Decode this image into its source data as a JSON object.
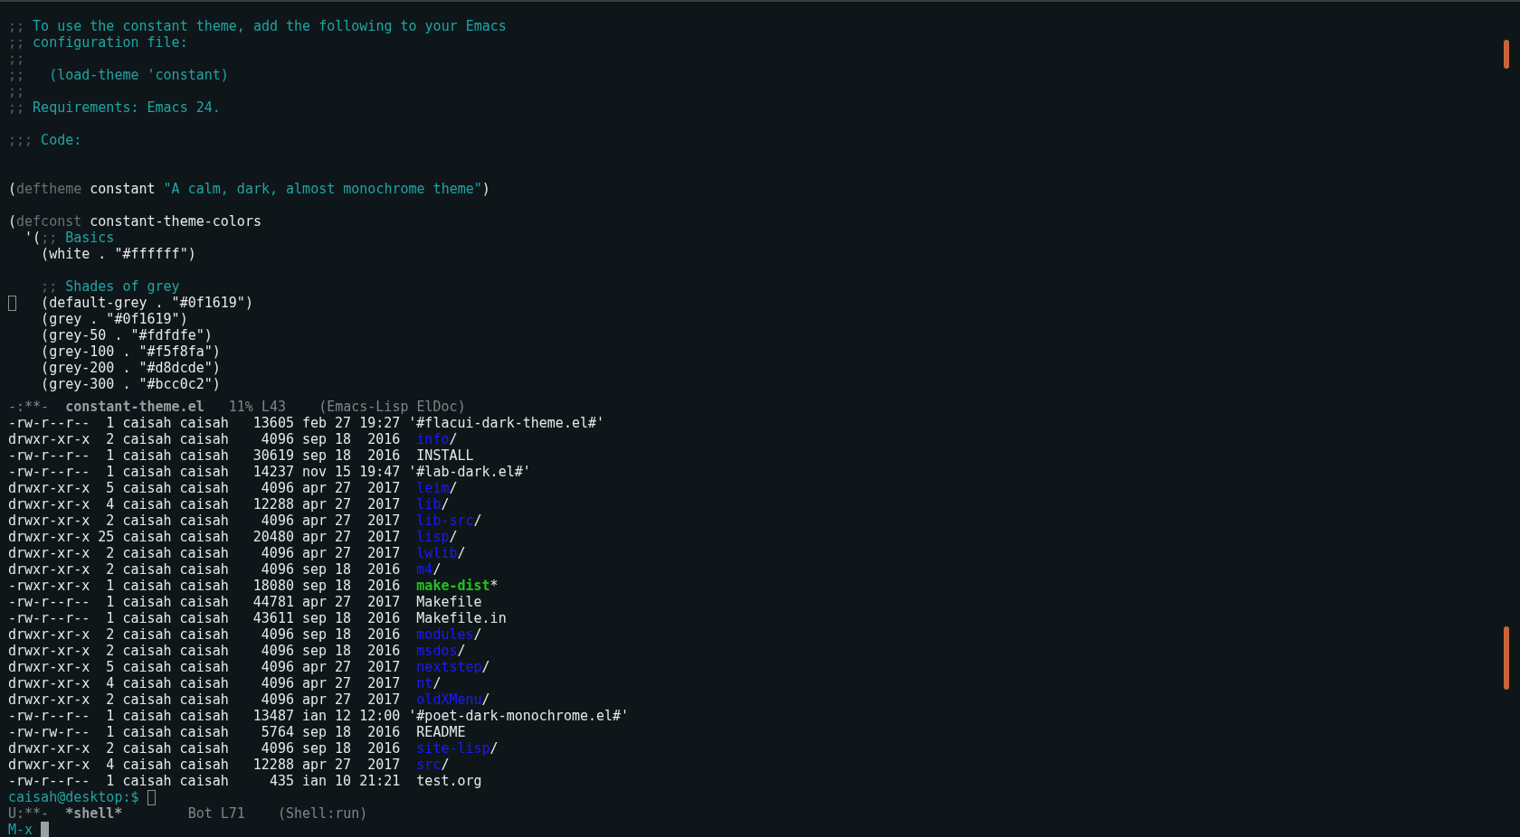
{
  "editor": {
    "blocks": [
      {
        "kind": "commentary",
        "lines": [
          {
            "cursor": false,
            "segments": [
              {
                "kind": "delimiter",
                "text": ";;"
              },
              {
                "kind": "comment",
                "text": " To use the constant theme, add the following to your Emacs"
              }
            ]
          },
          {
            "cursor": false,
            "segments": [
              {
                "kind": "delimiter",
                "text": ";;"
              },
              {
                "kind": "comment",
                "text": " configuration file:"
              }
            ]
          },
          {
            "cursor": false,
            "segments": [
              {
                "kind": "delimiter",
                "text": ";;"
              }
            ]
          },
          {
            "cursor": false,
            "segments": [
              {
                "kind": "delimiter",
                "text": ";;"
              },
              {
                "kind": "comment",
                "text": "   (load-theme 'constant)"
              }
            ]
          },
          {
            "cursor": false,
            "segments": [
              {
                "kind": "delimiter",
                "text": ";;"
              }
            ]
          },
          {
            "cursor": false,
            "segments": [
              {
                "kind": "delimiter",
                "text": ";;"
              },
              {
                "kind": "comment",
                "text": " Requirements: Emacs 24."
              }
            ]
          }
        ]
      },
      {
        "kind": "commentary",
        "lines": [
          {
            "cursor": false,
            "segments": [
              {
                "kind": "delimiter",
                "text": ";;;"
              },
              {
                "kind": "comment",
                "text": " Code:"
              }
            ]
          }
        ]
      },
      {
        "kind": "form",
        "lines": [
          {
            "cursor": false,
            "segments": [
              {
                "kind": "plain",
                "text": "("
              },
              {
                "kind": "keyword",
                "text": "deftheme"
              },
              {
                "kind": "plain",
                "text": " constant "
              },
              {
                "kind": "string",
                "text": "\"A calm, dark, almost monochrome theme\""
              },
              {
                "kind": "plain",
                "text": ")"
              }
            ]
          }
        ]
      },
      {
        "kind": "form",
        "lines": [
          {
            "cursor": false,
            "segments": [
              {
                "kind": "plain",
                "text": "("
              },
              {
                "kind": "keyword",
                "text": "defconst"
              },
              {
                "kind": "plain",
                "text": " constant-theme-colors"
              }
            ]
          },
          {
            "cursor": false,
            "segments": [
              {
                "kind": "plain",
                "text": "  '("
              },
              {
                "kind": "delimiter",
                "text": ";;"
              },
              {
                "kind": "comment",
                "text": " Basics"
              }
            ]
          },
          {
            "cursor": false,
            "segments": [
              {
                "kind": "plain",
                "text": "    (white . \"#ffffff\")"
              }
            ]
          }
        ]
      },
      {
        "kind": "form",
        "lines": [
          {
            "cursor": false,
            "segments": [
              {
                "kind": "delimiter",
                "text": "    ;;"
              },
              {
                "kind": "comment",
                "text": " Shades of grey"
              }
            ]
          },
          {
            "cursor": true,
            "segments": [
              {
                "kind": "plain",
                "text": "    (default-grey . \"#0f1619\")"
              }
            ]
          },
          {
            "cursor": false,
            "segments": [
              {
                "kind": "plain",
                "text": "    (grey . \"#0f1619\")"
              }
            ]
          },
          {
            "cursor": false,
            "segments": [
              {
                "kind": "plain",
                "text": "    (grey-50 . \"#fdfdfe\")"
              }
            ]
          },
          {
            "cursor": false,
            "segments": [
              {
                "kind": "plain",
                "text": "    (grey-100 . \"#f5f8fa\")"
              }
            ]
          },
          {
            "cursor": false,
            "segments": [
              {
                "kind": "plain",
                "text": "    (grey-200 . \"#d8dcde\")"
              }
            ]
          },
          {
            "cursor": false,
            "segments": [
              {
                "kind": "plain",
                "text": "    (grey-300 . \"#bcc0c2\")"
              }
            ]
          }
        ]
      }
    ],
    "mode_line": {
      "status": "-:**-",
      "buffer": "constant-theme.el",
      "position": "11% L43",
      "mode": "(Emacs-Lisp ElDoc)"
    }
  },
  "shell": {
    "listing": [
      {
        "permissions": "-rw-r--r--",
        "links": "1",
        "owner": "caisah",
        "group": "caisah",
        "size": "13605",
        "month": "feb",
        "day": "27",
        "time": "19:27",
        "name": "'#flacui-dark-theme.el#'",
        "kind": "quoted"
      },
      {
        "permissions": "drwxr-xr-x",
        "links": "2",
        "owner": "caisah",
        "group": "caisah",
        "size": "4096",
        "month": "sep",
        "day": "18",
        "time": "2016",
        "name": "info",
        "suffix": "/",
        "kind": "dir"
      },
      {
        "permissions": "-rw-r--r--",
        "links": "1",
        "owner": "caisah",
        "group": "caisah",
        "size": "30619",
        "month": "sep",
        "day": "18",
        "time": "2016",
        "name": "INSTALL",
        "kind": "file"
      },
      {
        "permissions": "-rw-r--r--",
        "links": "1",
        "owner": "caisah",
        "group": "caisah",
        "size": "14237",
        "month": "nov",
        "day": "15",
        "time": "19:47",
        "name": "'#lab-dark.el#'",
        "kind": "quoted"
      },
      {
        "permissions": "drwxr-xr-x",
        "links": "5",
        "owner": "caisah",
        "group": "caisah",
        "size": "4096",
        "month": "apr",
        "day": "27",
        "time": "2017",
        "name": "leim",
        "suffix": "/",
        "kind": "dir"
      },
      {
        "permissions": "drwxr-xr-x",
        "links": "4",
        "owner": "caisah",
        "group": "caisah",
        "size": "12288",
        "month": "apr",
        "day": "27",
        "time": "2017",
        "name": "lib",
        "suffix": "/",
        "kind": "dir"
      },
      {
        "permissions": "drwxr-xr-x",
        "links": "2",
        "owner": "caisah",
        "group": "caisah",
        "size": "4096",
        "month": "apr",
        "day": "27",
        "time": "2017",
        "name": "lib-src",
        "suffix": "/",
        "kind": "dir"
      },
      {
        "permissions": "drwxr-xr-x",
        "links": "25",
        "owner": "caisah",
        "group": "caisah",
        "size": "20480",
        "month": "apr",
        "day": "27",
        "time": "2017",
        "name": "lisp",
        "suffix": "/",
        "kind": "dir"
      },
      {
        "permissions": "drwxr-xr-x",
        "links": "2",
        "owner": "caisah",
        "group": "caisah",
        "size": "4096",
        "month": "apr",
        "day": "27",
        "time": "2017",
        "name": "lwlib",
        "suffix": "/",
        "kind": "dir"
      },
      {
        "permissions": "drwxr-xr-x",
        "links": "2",
        "owner": "caisah",
        "group": "caisah",
        "size": "4096",
        "month": "sep",
        "day": "18",
        "time": "2016",
        "name": "m4",
        "suffix": "/",
        "kind": "dir"
      },
      {
        "permissions": "-rwxr-xr-x",
        "links": "1",
        "owner": "caisah",
        "group": "caisah",
        "size": "18080",
        "month": "sep",
        "day": "18",
        "time": "2016",
        "name": "make-dist",
        "suffix": "*",
        "kind": "exec"
      },
      {
        "permissions": "-rw-r--r--",
        "links": "1",
        "owner": "caisah",
        "group": "caisah",
        "size": "44781",
        "month": "apr",
        "day": "27",
        "time": "2017",
        "name": "Makefile",
        "kind": "file"
      },
      {
        "permissions": "-rw-r--r--",
        "links": "1",
        "owner": "caisah",
        "group": "caisah",
        "size": "43611",
        "month": "sep",
        "day": "18",
        "time": "2016",
        "name": "Makefile.in",
        "kind": "file"
      },
      {
        "permissions": "drwxr-xr-x",
        "links": "2",
        "owner": "caisah",
        "group": "caisah",
        "size": "4096",
        "month": "sep",
        "day": "18",
        "time": "2016",
        "name": "modules",
        "suffix": "/",
        "kind": "dir"
      },
      {
        "permissions": "drwxr-xr-x",
        "links": "2",
        "owner": "caisah",
        "group": "caisah",
        "size": "4096",
        "month": "sep",
        "day": "18",
        "time": "2016",
        "name": "msdos",
        "suffix": "/",
        "kind": "dir"
      },
      {
        "permissions": "drwxr-xr-x",
        "links": "5",
        "owner": "caisah",
        "group": "caisah",
        "size": "4096",
        "month": "apr",
        "day": "27",
        "time": "2017",
        "name": "nextstep",
        "suffix": "/",
        "kind": "dir"
      },
      {
        "permissions": "drwxr-xr-x",
        "links": "4",
        "owner": "caisah",
        "group": "caisah",
        "size": "4096",
        "month": "apr",
        "day": "27",
        "time": "2017",
        "name": "nt",
        "suffix": "/",
        "kind": "dir"
      },
      {
        "permissions": "drwxr-xr-x",
        "links": "2",
        "owner": "caisah",
        "group": "caisah",
        "size": "4096",
        "month": "apr",
        "day": "27",
        "time": "2017",
        "name": "oldXMenu",
        "suffix": "/",
        "kind": "dir"
      },
      {
        "permissions": "-rw-r--r--",
        "links": "1",
        "owner": "caisah",
        "group": "caisah",
        "size": "13487",
        "month": "ian",
        "day": "12",
        "time": "12:00",
        "name": "'#poet-dark-monochrome.el#'",
        "kind": "quoted"
      },
      {
        "permissions": "-rw-rw-r--",
        "links": "1",
        "owner": "caisah",
        "group": "caisah",
        "size": "5764",
        "month": "sep",
        "day": "18",
        "time": "2016",
        "name": "README",
        "kind": "file"
      },
      {
        "permissions": "drwxr-xr-x",
        "links": "2",
        "owner": "caisah",
        "group": "caisah",
        "size": "4096",
        "month": "sep",
        "day": "18",
        "time": "2016",
        "name": "site-lisp",
        "suffix": "/",
        "kind": "dir"
      },
      {
        "permissions": "drwxr-xr-x",
        "links": "4",
        "owner": "caisah",
        "group": "caisah",
        "size": "12288",
        "month": "apr",
        "day": "27",
        "time": "2017",
        "name": "src",
        "suffix": "/",
        "kind": "dir"
      },
      {
        "permissions": "-rw-r--r--",
        "links": "1",
        "owner": "caisah",
        "group": "caisah",
        "size": "435",
        "month": "ian",
        "day": "10",
        "time": "21:21",
        "name": "test.org",
        "kind": "file"
      }
    ],
    "prompt": {
      "text": "caisah@desktop:$",
      "cursor": true
    },
    "mode_line": {
      "status": "U:**-",
      "buffer": "*shell*",
      "position": "Bot L71",
      "mode": "(Shell:run)"
    }
  },
  "minibuffer": {
    "prompt": "M-x",
    "cursor": true
  }
}
